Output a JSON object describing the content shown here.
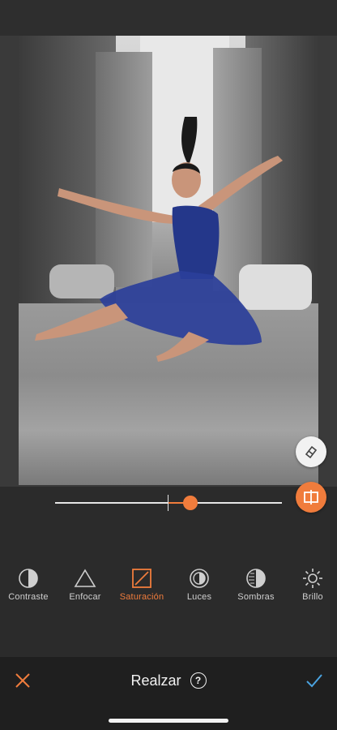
{
  "editor": {
    "slider": {
      "value": 0.12,
      "accent": "#f07c3c"
    },
    "side_tools": [
      {
        "name": "eraser-icon"
      },
      {
        "name": "compare-icon"
      }
    ]
  },
  "tools": [
    {
      "label": "Contraste",
      "icon": "contrast-icon",
      "active": false
    },
    {
      "label": "Enfocar",
      "icon": "triangle-icon",
      "active": false
    },
    {
      "label": "Saturación",
      "icon": "saturation-icon",
      "active": true
    },
    {
      "label": "Luces",
      "icon": "highlights-icon",
      "active": false
    },
    {
      "label": "Sombras",
      "icon": "shadows-icon",
      "active": false
    },
    {
      "label": "Brillo",
      "icon": "brightness-icon",
      "active": false
    }
  ],
  "bottombar": {
    "title": "Realzar",
    "help": "?",
    "cancel_icon": "close-icon",
    "confirm_icon": "check-icon"
  },
  "colors": {
    "accent": "#f07c3c",
    "confirm": "#4aa3e0"
  }
}
